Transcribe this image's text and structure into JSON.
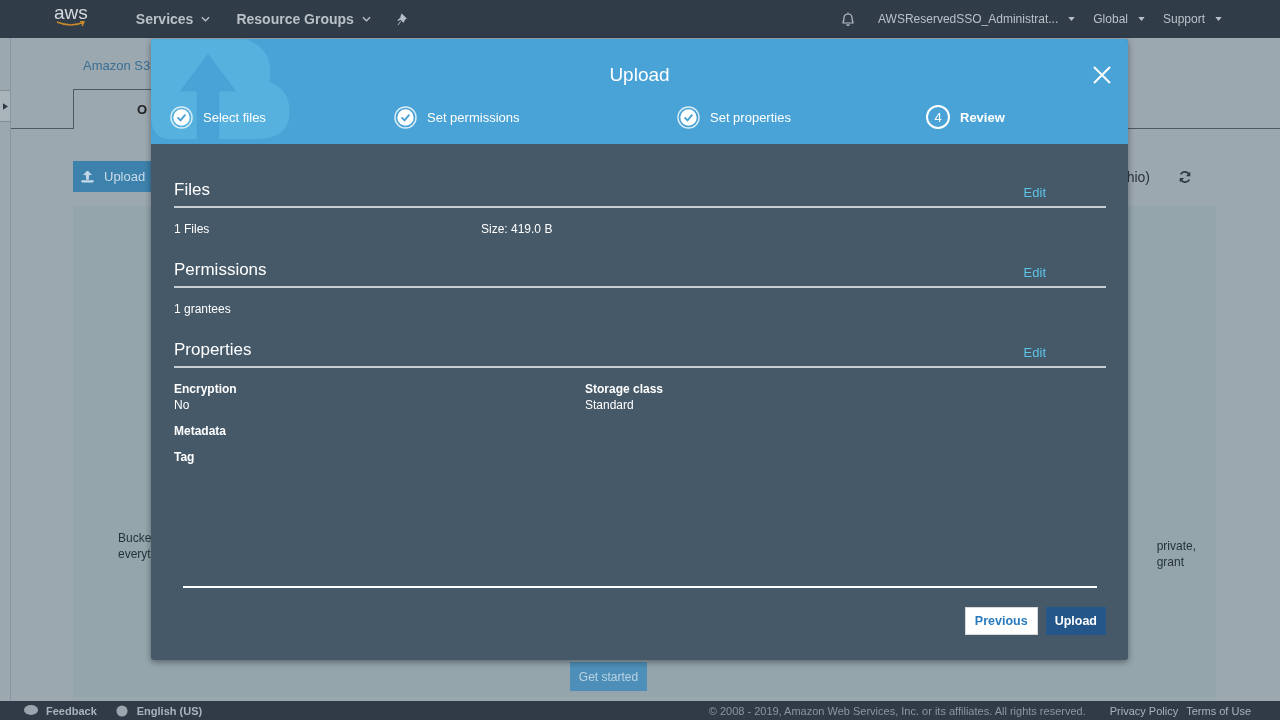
{
  "nav": {
    "logo": "aws",
    "items": [
      {
        "label": "Services"
      },
      {
        "label": "Resource Groups"
      }
    ],
    "account": "AWSReservedSSO_Administrat...",
    "region": "Global",
    "support": "Support"
  },
  "background": {
    "breadcrumb": "Amazon S3",
    "tab": "O",
    "upload_button": "Upload",
    "region_fragment": "hio)",
    "text_left": [
      "Bucke",
      "everyt"
    ],
    "text_right": [
      "private,",
      "grant"
    ],
    "get_started": "Get started"
  },
  "modal": {
    "title": "Upload",
    "steps": [
      {
        "label": "Select files",
        "done": true,
        "selected": false
      },
      {
        "label": "Set permissions",
        "done": true,
        "selected": false
      },
      {
        "label": "Set properties",
        "done": true,
        "selected": false
      },
      {
        "label": "Review",
        "done": false,
        "number": "4",
        "selected": true
      }
    ],
    "sections": [
      {
        "title": "Files",
        "action": "Edit",
        "kind": "inline",
        "items": [
          {
            "value": "1 Files"
          },
          {
            "value": "Size: 419.0 B"
          }
        ]
      },
      {
        "title": "Permissions",
        "action": "Edit",
        "kind": "inline",
        "items": [
          {
            "value": "1 grantees"
          }
        ]
      },
      {
        "title": "Properties",
        "action": "Edit",
        "kind": "fields",
        "items": [
          {
            "label": "Encryption",
            "value": "No"
          },
          {
            "label": "Storage class",
            "value": "Standard"
          },
          {
            "label": "Metadata"
          },
          {
            "label": "Tag"
          }
        ]
      }
    ],
    "buttons": [
      {
        "label": "Previous",
        "kind": "secondary"
      },
      {
        "label": "Upload",
        "kind": "primary"
      }
    ]
  },
  "footer": {
    "feedback": "Feedback",
    "language": "English (US)",
    "copyright": "© 2008 - 2019, Amazon Web Services, Inc. or its affiliates. All rights reserved.",
    "links": [
      "Privacy Policy",
      "Terms of Use"
    ]
  }
}
